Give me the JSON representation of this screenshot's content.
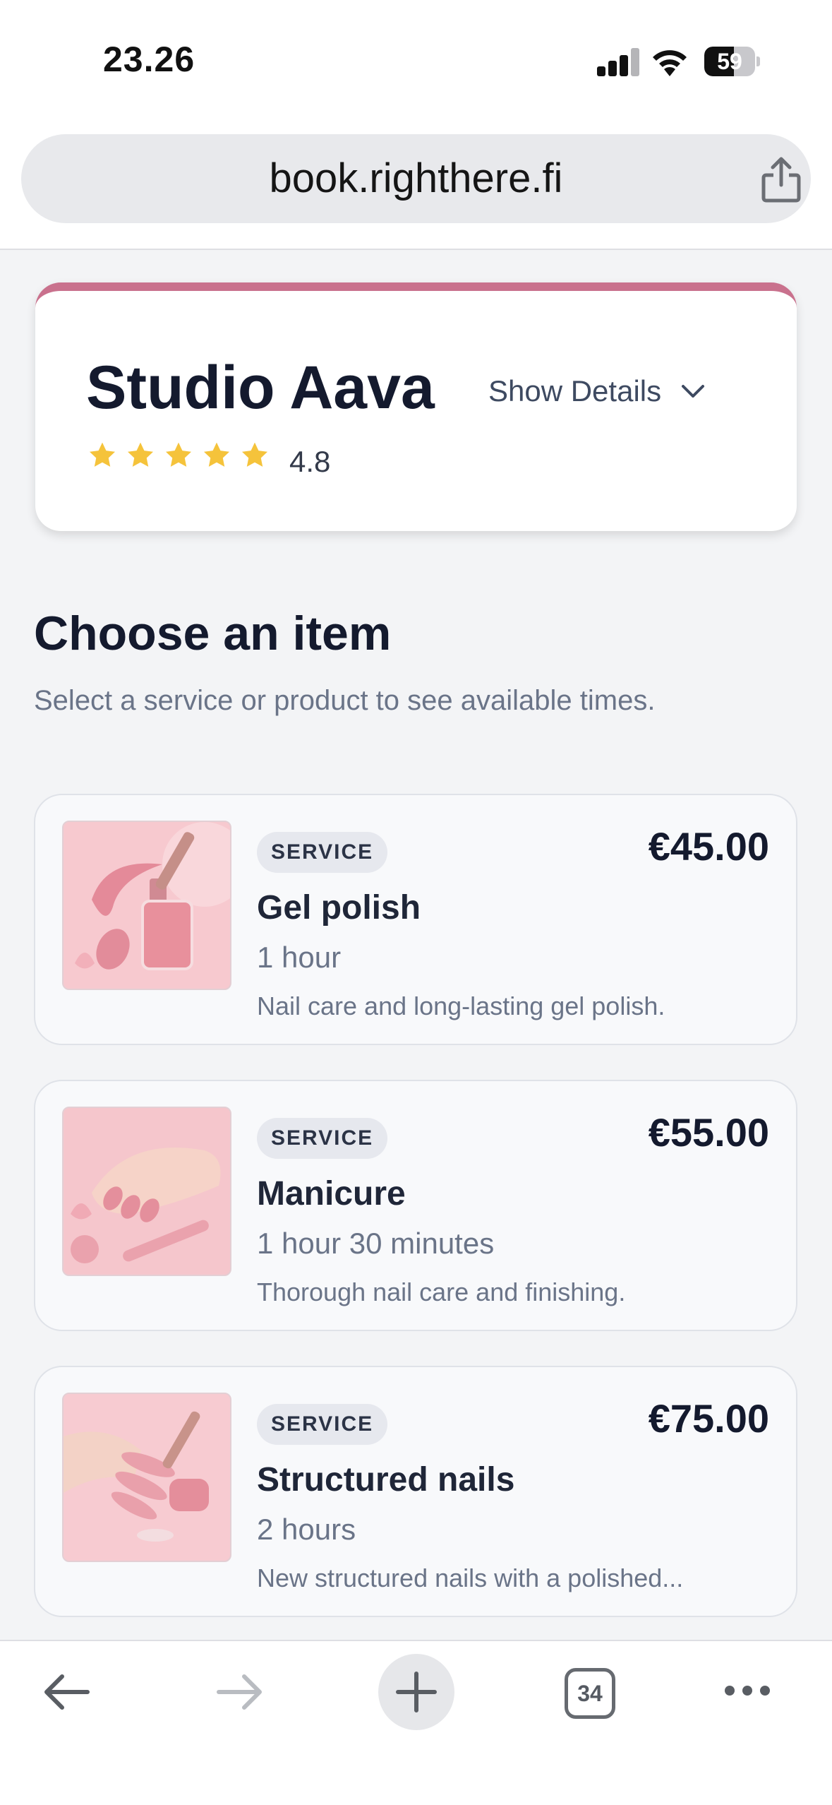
{
  "status_bar": {
    "time": "23.26",
    "battery": "59",
    "battery_level": 0.59
  },
  "browser": {
    "url": "book.righthere.fi",
    "tab_count": "34"
  },
  "business": {
    "name": "Studio Aava",
    "show_details_label": "Show Details",
    "rating": "4.8",
    "stars": 5,
    "accent_color": "#c9718d"
  },
  "section": {
    "title": "Choose an item",
    "subtitle": "Select a service or product to see available times."
  },
  "items": [
    {
      "badge": "SERVICE",
      "name": "Gel polish",
      "duration": "1 hour",
      "description": "Nail care and long-lasting gel polish.",
      "price": "€45.00",
      "image": "nail-polish-image"
    },
    {
      "badge": "SERVICE",
      "name": "Manicure",
      "duration": "1 hour 30 minutes",
      "description": "Thorough nail care and finishing.",
      "price": "€55.00",
      "image": "manicure-hand-image"
    },
    {
      "badge": "SERVICE",
      "name": "Structured nails",
      "duration": "2 hours",
      "description": "New structured nails with a polished...",
      "price": "€75.00",
      "image": "structured-nails-image"
    }
  ]
}
